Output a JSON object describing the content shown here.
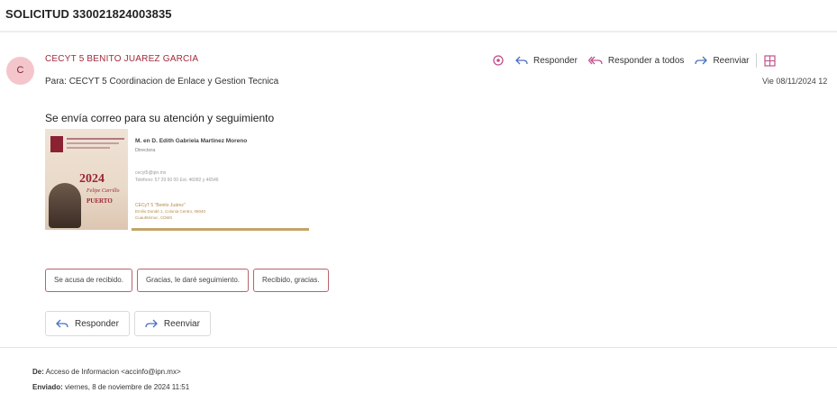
{
  "subject": "SOLICITUD 330021824003835",
  "message": {
    "avatar_initial": "C",
    "sender": "CECYT 5 BENITO JUAREZ GARCIA",
    "to_label": "Para:",
    "to": "CECYT 5 Coordinacion de Enlace y Gestion Tecnica",
    "date": "Vie 08/11/2024 12",
    "body": "Se envía correo para su atención y seguimiento"
  },
  "actions": {
    "reply": "Responder",
    "reply_all": "Responder a todos",
    "forward": "Reenviar"
  },
  "signature": {
    "name": "M. en D. Edith Gabriela Martinez Moreno",
    "role": "Directora",
    "email": "cecyt5@ipn.mx",
    "phone": "Teléfono: 57 29 60 00 Ext. 46082 y 46546",
    "school": "CECyT 5 \"Benito Juárez\"",
    "address1": "Emilio Dondé 1, Colonia Centro, 06040",
    "address2": "Cuauhtémoc, CDMX",
    "year": "2024",
    "banner1": "Felipe Carrillo",
    "banner2": "PUERTO"
  },
  "quick_replies": [
    "Se acusa de recibido.",
    "Gracias, le daré seguimiento.",
    "Recibido, gracias."
  ],
  "reply_buttons": {
    "reply": "Responder",
    "forward": "Reenviar"
  },
  "quoted": {
    "from_label": "De:",
    "from": "Acceso de Informacion <accinfo@ipn.mx>",
    "sent_label": "Enviado:",
    "sent": "viernes, 8 de noviembre de 2024 11:51"
  },
  "colors": {
    "accent": "#a12a3a",
    "avatar_bg": "#f4c6cc",
    "action_icon": "#4a6fc7"
  },
  "icons": [
    "sparkle-icon",
    "reply-icon",
    "reply-all-icon",
    "forward-icon",
    "grid-icon"
  ]
}
